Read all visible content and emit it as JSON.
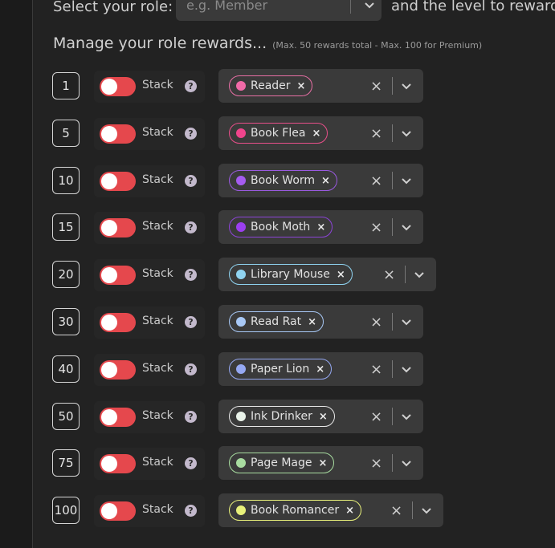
{
  "header": {
    "select_role_label": "Select your role:",
    "role_placeholder": "e.g. Member",
    "level_label": "and the level to reward"
  },
  "section": {
    "title": "Manage your role rewards...",
    "note": "(Max. 50 rewards total - Max. 100 for Premium)"
  },
  "stack_label": "Stack",
  "help_glyph": "?",
  "colors": {
    "toggle_off": "#e5484d",
    "pink": "#e86fa5",
    "purple": "#a55cf0",
    "cyan": "#8fd3f0",
    "lightblue": "#9ec3f7",
    "periwinkle": "#9aa7f0",
    "white": "#e8f0e8",
    "green": "#a8dca0",
    "yellow": "#e8f07a"
  },
  "rewards": [
    {
      "level": "1",
      "role": "Reader",
      "dot": "#f06aa7",
      "border": "#e86fa5"
    },
    {
      "level": "5",
      "role": "Book Flea",
      "dot": "#f0448c",
      "border": "#e84f8a"
    },
    {
      "level": "10",
      "role": "Book Worm",
      "dot": "#a55cf0",
      "border": "#9a5ae0"
    },
    {
      "level": "15",
      "role": "Book Moth",
      "dot": "#9b3ff0",
      "border": "#8d44d8"
    },
    {
      "level": "20",
      "role": "Library Mouse",
      "dot": "#8fd3f0",
      "border": "#8fd3f0"
    },
    {
      "level": "30",
      "role": "Read Rat",
      "dot": "#a8c8f5",
      "border": "#a8c8f5"
    },
    {
      "level": "40",
      "role": "Paper Lion",
      "dot": "#95a8f2",
      "border": "#95a8f2"
    },
    {
      "level": "50",
      "role": "Ink Drinker",
      "dot": "#eaf3ea",
      "border": "#e8e8e8"
    },
    {
      "level": "75",
      "role": "Page Mage",
      "dot": "#a8dca0",
      "border": "#a8dca0"
    },
    {
      "level": "100",
      "role": "Book Romancer",
      "dot": "#e8f07a",
      "border": "#e8f07a"
    }
  ]
}
